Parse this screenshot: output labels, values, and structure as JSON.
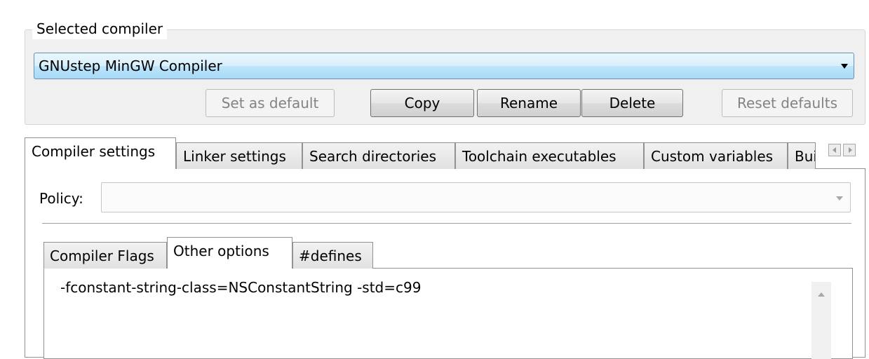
{
  "selected_compiler": {
    "group_label": "Selected compiler",
    "current": "GNUstep MinGW Compiler",
    "buttons": {
      "set_default": "Set as default",
      "copy": "Copy",
      "rename": "Rename",
      "delete": "Delete",
      "reset_defaults": "Reset defaults"
    }
  },
  "tabs": [
    {
      "label": "Compiler settings",
      "active": true
    },
    {
      "label": "Linker settings"
    },
    {
      "label": "Search directories"
    },
    {
      "label": "Toolchain executables"
    },
    {
      "label": "Custom variables"
    },
    {
      "label": "Bui"
    }
  ],
  "policy": {
    "label": "Policy:",
    "value": ""
  },
  "inner_tabs": [
    {
      "label": "Compiler Flags"
    },
    {
      "label": "Other options",
      "active": true
    },
    {
      "label": "#defines"
    }
  ],
  "other_options_text": "-fconstant-string-class=NSConstantString -std=c99"
}
